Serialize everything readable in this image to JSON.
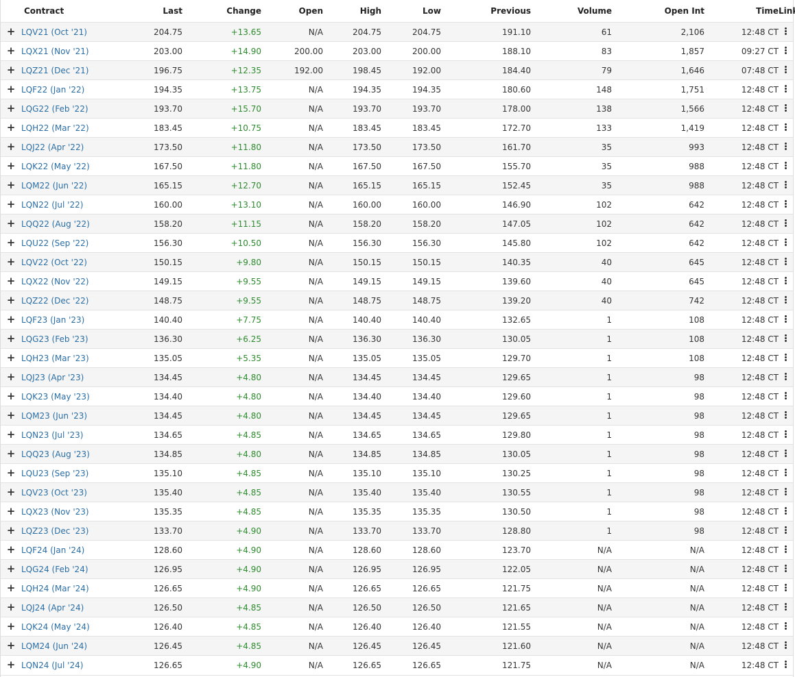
{
  "table": {
    "headers": {
      "contract": "Contract",
      "last": "Last",
      "change": "Change",
      "open": "Open",
      "high": "High",
      "low": "Low",
      "previous": "Previous",
      "volume": "Volume",
      "open_int": "Open Int",
      "time": "Time",
      "links": "Links"
    },
    "colors": {
      "change_positive": "#2e8b2e",
      "link": "#2a6ea6"
    },
    "expand_icon": "plus-icon",
    "links_icon": "vertical-dots-icon",
    "rows": [
      {
        "contract": "LQV21 (Oct '21)",
        "last": "204.75",
        "change": "+13.65",
        "open": "N/A",
        "high": "204.75",
        "low": "204.75",
        "previous": "191.10",
        "volume": "61",
        "open_int": "2,106",
        "time": "12:48 CT"
      },
      {
        "contract": "LQX21 (Nov '21)",
        "last": "203.00",
        "change": "+14.90",
        "open": "200.00",
        "high": "203.00",
        "low": "200.00",
        "previous": "188.10",
        "volume": "83",
        "open_int": "1,857",
        "time": "09:27 CT"
      },
      {
        "contract": "LQZ21 (Dec '21)",
        "last": "196.75",
        "change": "+12.35",
        "open": "192.00",
        "high": "198.45",
        "low": "192.00",
        "previous": "184.40",
        "volume": "79",
        "open_int": "1,646",
        "time": "07:48 CT"
      },
      {
        "contract": "LQF22 (Jan '22)",
        "last": "194.35",
        "change": "+13.75",
        "open": "N/A",
        "high": "194.35",
        "low": "194.35",
        "previous": "180.60",
        "volume": "148",
        "open_int": "1,751",
        "time": "12:48 CT"
      },
      {
        "contract": "LQG22 (Feb '22)",
        "last": "193.70",
        "change": "+15.70",
        "open": "N/A",
        "high": "193.70",
        "low": "193.70",
        "previous": "178.00",
        "volume": "138",
        "open_int": "1,566",
        "time": "12:48 CT"
      },
      {
        "contract": "LQH22 (Mar '22)",
        "last": "183.45",
        "change": "+10.75",
        "open": "N/A",
        "high": "183.45",
        "low": "183.45",
        "previous": "172.70",
        "volume": "133",
        "open_int": "1,419",
        "time": "12:48 CT"
      },
      {
        "contract": "LQJ22 (Apr '22)",
        "last": "173.50",
        "change": "+11.80",
        "open": "N/A",
        "high": "173.50",
        "low": "173.50",
        "previous": "161.70",
        "volume": "35",
        "open_int": "993",
        "time": "12:48 CT"
      },
      {
        "contract": "LQK22 (May '22)",
        "last": "167.50",
        "change": "+11.80",
        "open": "N/A",
        "high": "167.50",
        "low": "167.50",
        "previous": "155.70",
        "volume": "35",
        "open_int": "988",
        "time": "12:48 CT"
      },
      {
        "contract": "LQM22 (Jun '22)",
        "last": "165.15",
        "change": "+12.70",
        "open": "N/A",
        "high": "165.15",
        "low": "165.15",
        "previous": "152.45",
        "volume": "35",
        "open_int": "988",
        "time": "12:48 CT"
      },
      {
        "contract": "LQN22 (Jul '22)",
        "last": "160.00",
        "change": "+13.10",
        "open": "N/A",
        "high": "160.00",
        "low": "160.00",
        "previous": "146.90",
        "volume": "102",
        "open_int": "642",
        "time": "12:48 CT"
      },
      {
        "contract": "LQQ22 (Aug '22)",
        "last": "158.20",
        "change": "+11.15",
        "open": "N/A",
        "high": "158.20",
        "low": "158.20",
        "previous": "147.05",
        "volume": "102",
        "open_int": "642",
        "time": "12:48 CT"
      },
      {
        "contract": "LQU22 (Sep '22)",
        "last": "156.30",
        "change": "+10.50",
        "open": "N/A",
        "high": "156.30",
        "low": "156.30",
        "previous": "145.80",
        "volume": "102",
        "open_int": "642",
        "time": "12:48 CT"
      },
      {
        "contract": "LQV22 (Oct '22)",
        "last": "150.15",
        "change": "+9.80",
        "open": "N/A",
        "high": "150.15",
        "low": "150.15",
        "previous": "140.35",
        "volume": "40",
        "open_int": "645",
        "time": "12:48 CT"
      },
      {
        "contract": "LQX22 (Nov '22)",
        "last": "149.15",
        "change": "+9.55",
        "open": "N/A",
        "high": "149.15",
        "low": "149.15",
        "previous": "139.60",
        "volume": "40",
        "open_int": "645",
        "time": "12:48 CT"
      },
      {
        "contract": "LQZ22 (Dec '22)",
        "last": "148.75",
        "change": "+9.55",
        "open": "N/A",
        "high": "148.75",
        "low": "148.75",
        "previous": "139.20",
        "volume": "40",
        "open_int": "742",
        "time": "12:48 CT"
      },
      {
        "contract": "LQF23 (Jan '23)",
        "last": "140.40",
        "change": "+7.75",
        "open": "N/A",
        "high": "140.40",
        "low": "140.40",
        "previous": "132.65",
        "volume": "1",
        "open_int": "108",
        "time": "12:48 CT"
      },
      {
        "contract": "LQG23 (Feb '23)",
        "last": "136.30",
        "change": "+6.25",
        "open": "N/A",
        "high": "136.30",
        "low": "136.30",
        "previous": "130.05",
        "volume": "1",
        "open_int": "108",
        "time": "12:48 CT"
      },
      {
        "contract": "LQH23 (Mar '23)",
        "last": "135.05",
        "change": "+5.35",
        "open": "N/A",
        "high": "135.05",
        "low": "135.05",
        "previous": "129.70",
        "volume": "1",
        "open_int": "108",
        "time": "12:48 CT"
      },
      {
        "contract": "LQJ23 (Apr '23)",
        "last": "134.45",
        "change": "+4.80",
        "open": "N/A",
        "high": "134.45",
        "low": "134.45",
        "previous": "129.65",
        "volume": "1",
        "open_int": "98",
        "time": "12:48 CT"
      },
      {
        "contract": "LQK23 (May '23)",
        "last": "134.40",
        "change": "+4.80",
        "open": "N/A",
        "high": "134.40",
        "low": "134.40",
        "previous": "129.60",
        "volume": "1",
        "open_int": "98",
        "time": "12:48 CT"
      },
      {
        "contract": "LQM23 (Jun '23)",
        "last": "134.45",
        "change": "+4.80",
        "open": "N/A",
        "high": "134.45",
        "low": "134.45",
        "previous": "129.65",
        "volume": "1",
        "open_int": "98",
        "time": "12:48 CT"
      },
      {
        "contract": "LQN23 (Jul '23)",
        "last": "134.65",
        "change": "+4.85",
        "open": "N/A",
        "high": "134.65",
        "low": "134.65",
        "previous": "129.80",
        "volume": "1",
        "open_int": "98",
        "time": "12:48 CT"
      },
      {
        "contract": "LQQ23 (Aug '23)",
        "last": "134.85",
        "change": "+4.80",
        "open": "N/A",
        "high": "134.85",
        "low": "134.85",
        "previous": "130.05",
        "volume": "1",
        "open_int": "98",
        "time": "12:48 CT"
      },
      {
        "contract": "LQU23 (Sep '23)",
        "last": "135.10",
        "change": "+4.85",
        "open": "N/A",
        "high": "135.10",
        "low": "135.10",
        "previous": "130.25",
        "volume": "1",
        "open_int": "98",
        "time": "12:48 CT"
      },
      {
        "contract": "LQV23 (Oct '23)",
        "last": "135.40",
        "change": "+4.85",
        "open": "N/A",
        "high": "135.40",
        "low": "135.40",
        "previous": "130.55",
        "volume": "1",
        "open_int": "98",
        "time": "12:48 CT"
      },
      {
        "contract": "LQX23 (Nov '23)",
        "last": "135.35",
        "change": "+4.85",
        "open": "N/A",
        "high": "135.35",
        "low": "135.35",
        "previous": "130.50",
        "volume": "1",
        "open_int": "98",
        "time": "12:48 CT"
      },
      {
        "contract": "LQZ23 (Dec '23)",
        "last": "133.70",
        "change": "+4.90",
        "open": "N/A",
        "high": "133.70",
        "low": "133.70",
        "previous": "128.80",
        "volume": "1",
        "open_int": "98",
        "time": "12:48 CT"
      },
      {
        "contract": "LQF24 (Jan '24)",
        "last": "128.60",
        "change": "+4.90",
        "open": "N/A",
        "high": "128.60",
        "low": "128.60",
        "previous": "123.70",
        "volume": "N/A",
        "open_int": "N/A",
        "time": "12:48 CT"
      },
      {
        "contract": "LQG24 (Feb '24)",
        "last": "126.95",
        "change": "+4.90",
        "open": "N/A",
        "high": "126.95",
        "low": "126.95",
        "previous": "122.05",
        "volume": "N/A",
        "open_int": "N/A",
        "time": "12:48 CT"
      },
      {
        "contract": "LQH24 (Mar '24)",
        "last": "126.65",
        "change": "+4.90",
        "open": "N/A",
        "high": "126.65",
        "low": "126.65",
        "previous": "121.75",
        "volume": "N/A",
        "open_int": "N/A",
        "time": "12:48 CT"
      },
      {
        "contract": "LQJ24 (Apr '24)",
        "last": "126.50",
        "change": "+4.85",
        "open": "N/A",
        "high": "126.50",
        "low": "126.50",
        "previous": "121.65",
        "volume": "N/A",
        "open_int": "N/A",
        "time": "12:48 CT"
      },
      {
        "contract": "LQK24 (May '24)",
        "last": "126.40",
        "change": "+4.85",
        "open": "N/A",
        "high": "126.40",
        "low": "126.40",
        "previous": "121.55",
        "volume": "N/A",
        "open_int": "N/A",
        "time": "12:48 CT"
      },
      {
        "contract": "LQM24 (Jun '24)",
        "last": "126.45",
        "change": "+4.85",
        "open": "N/A",
        "high": "126.45",
        "low": "126.45",
        "previous": "121.60",
        "volume": "N/A",
        "open_int": "N/A",
        "time": "12:48 CT"
      },
      {
        "contract": "LQN24 (Jul '24)",
        "last": "126.65",
        "change": "+4.90",
        "open": "N/A",
        "high": "126.65",
        "low": "126.65",
        "previous": "121.75",
        "volume": "N/A",
        "open_int": "N/A",
        "time": "12:48 CT"
      }
    ]
  }
}
